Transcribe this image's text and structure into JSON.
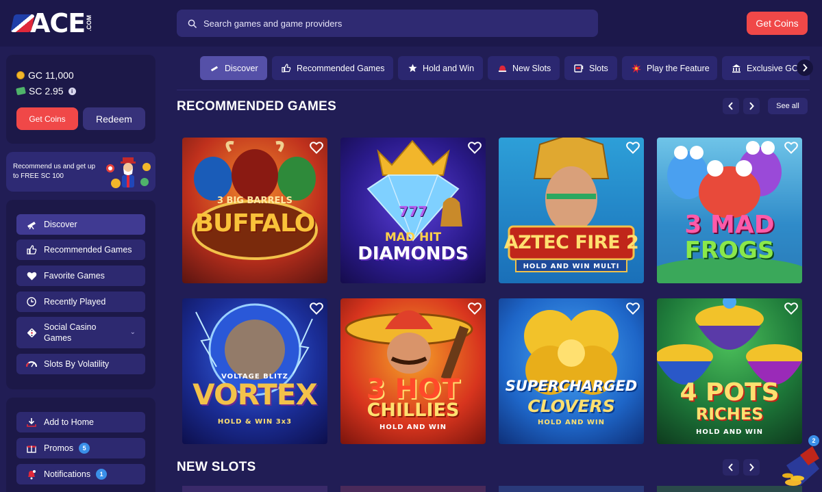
{
  "header": {
    "logo_text": "ACE",
    "logo_suffix": ".COM",
    "search_placeholder": "Search games and game providers",
    "get_coins_label": "Get Coins"
  },
  "wallet": {
    "gc_label": "GC 11,000",
    "sc_label": "SC 2.95",
    "get_coins_label": "Get Coins",
    "redeem_label": "Redeem"
  },
  "promo_banner": {
    "text": "Recommend us and get up to FREE SC 100"
  },
  "sidebar": {
    "items": [
      {
        "label": "Discover",
        "icon": "telescope-icon",
        "active": true
      },
      {
        "label": "Recommended Games",
        "icon": "thumbs-up-icon"
      },
      {
        "label": "Favorite Games",
        "icon": "heart-icon"
      },
      {
        "label": "Recently Played",
        "icon": "clock-icon"
      },
      {
        "label": "Social Casino Games",
        "icon": "dice-icon",
        "expandable": true
      },
      {
        "label": "Slots By Volatility",
        "icon": "gauge-icon"
      }
    ],
    "utilities": [
      {
        "label": "Add to Home",
        "icon": "download-icon"
      },
      {
        "label": "Promos",
        "icon": "gift-icon",
        "badge": "5"
      },
      {
        "label": "Notifications",
        "icon": "bell-icon",
        "badge": "1"
      }
    ]
  },
  "categories": [
    {
      "label": "Discover",
      "icon": "telescope-icon",
      "active": true
    },
    {
      "label": "Recommended Games",
      "icon": "thumbs-up-icon"
    },
    {
      "label": "Hold and Win",
      "icon": "star-icon"
    },
    {
      "label": "New Slots",
      "icon": "siren-icon"
    },
    {
      "label": "Slots",
      "icon": "slot-machine-icon"
    },
    {
      "label": "Play the Feature",
      "icon": "burst-icon"
    },
    {
      "label": "Exclusive GC",
      "icon": "bank-icon"
    }
  ],
  "sections": {
    "recommended": {
      "title": "RECOMMENDED GAMES",
      "see_all_label": "See all",
      "games": [
        {
          "line1": "3 BIG BARRELS",
          "line2": "BUFFALO"
        },
        {
          "line1": "MAD HIT",
          "line2": "DIAMONDS",
          "line0": "777"
        },
        {
          "line1": "AZTEC FIRE 2",
          "line2": "HOLD AND WIN MULTI"
        },
        {
          "line1": "3 MAD",
          "line2": "FROGS"
        },
        {
          "line0": "VOLTAGE BLITZ",
          "line1": "VORTEX",
          "line2": "HOLD & WIN 3x3"
        },
        {
          "line1": "3 HOT",
          "line2": "CHILLIES",
          "line3": "HOLD AND WIN"
        },
        {
          "line1": "SUPERCHARGED",
          "line2": "CLOVERS",
          "line3": "HOLD AND WIN"
        },
        {
          "line1": "4 POTS",
          "line2": "RICHES",
          "line3": "HOLD AND WIN"
        }
      ]
    },
    "new_slots": {
      "title": "NEW SLOTS"
    }
  },
  "floating_widget": {
    "badge": "2"
  },
  "colors": {
    "background": "#211d55",
    "header": "#1c184b",
    "accent_red": "#f04848",
    "panel": "#1c1848",
    "nav_item": "#2d2970",
    "badge_blue": "#3a8fe8"
  }
}
